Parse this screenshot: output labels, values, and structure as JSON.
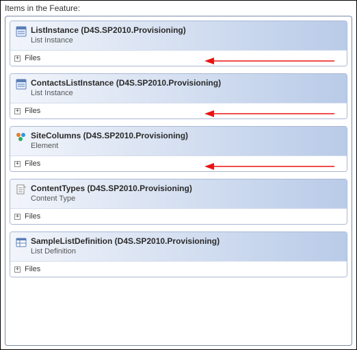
{
  "section_label": "Items in the Feature:",
  "files_label": "Files",
  "items": [
    {
      "title": "ListInstance (D4S.SP2010.Provisioning)",
      "subtitle": "List Instance",
      "icon": "list-instance-icon",
      "arrow": true
    },
    {
      "title": "ContactsListInstance (D4S.SP2010.Provisioning)",
      "subtitle": "List Instance",
      "icon": "list-instance-icon",
      "arrow": true
    },
    {
      "title": "SiteColumns (D4S.SP2010.Provisioning)",
      "subtitle": "Element",
      "icon": "element-icon",
      "arrow": true
    },
    {
      "title": "ContentTypes (D4S.SP2010.Provisioning)",
      "subtitle": "Content Type",
      "icon": "content-type-icon",
      "arrow": false
    },
    {
      "title": "SampleListDefinition (D4S.SP2010.Provisioning)",
      "subtitle": "List Definition",
      "icon": "list-definition-icon",
      "arrow": false
    }
  ]
}
